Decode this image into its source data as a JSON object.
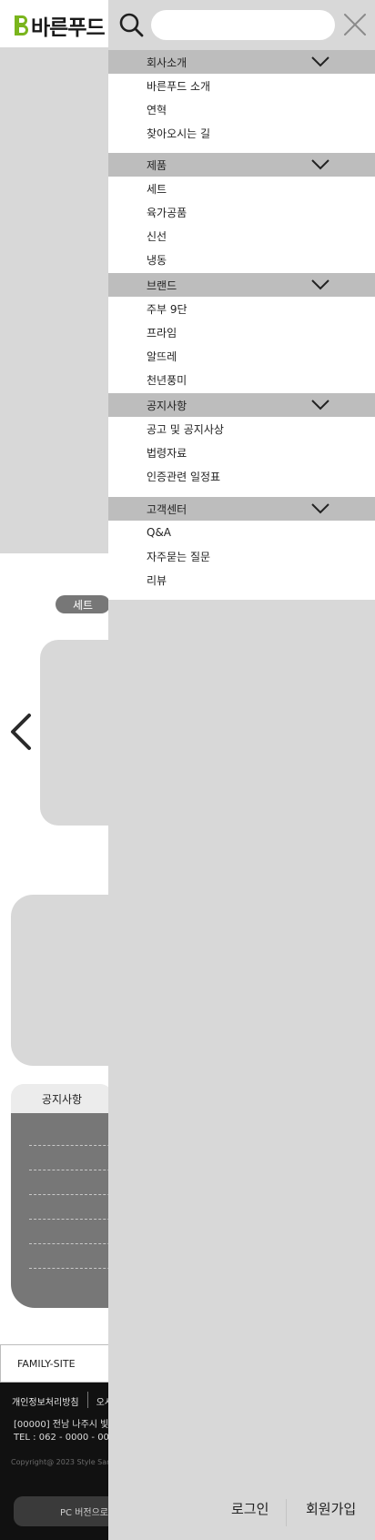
{
  "brand": {
    "logo_text": "바른푸드",
    "accent_color": "#7ab51d"
  },
  "page": {
    "badge": "세트",
    "notice_tab": "공지사항",
    "family_site": "FAMILY-SITE",
    "footer": {
      "link_privacy": "개인정보처리방침",
      "link_second": "오시",
      "address": "[00000] 전남 나주시 빛",
      "tel": "TEL : 062 - 0000 - 00",
      "copyright": "Copyright@ 2023 Style Sand",
      "pc_button": "PC 버전으로"
    }
  },
  "menu": {
    "search": {
      "value": "",
      "placeholder": ""
    },
    "sections": [
      {
        "title": "회사소개",
        "items": [
          "바른푸드 소개",
          "연혁",
          "찾아오시는 길"
        ]
      },
      {
        "title": "제품",
        "items": [
          "세트",
          "육가공품",
          "신선",
          "냉동"
        ]
      },
      {
        "title": "브랜드",
        "items": [
          "주부 9단",
          "프라임",
          "알뜨레",
          "천년풍미"
        ]
      },
      {
        "title": "공지사항",
        "items": [
          "공고 및 공지사상",
          "법령자료",
          "인증관련 일정표"
        ]
      },
      {
        "title": "고객센터",
        "items": [
          "Q&A",
          "자주묻는 질문",
          "리뷰"
        ]
      }
    ],
    "login": "로그인",
    "signup": "회원가입"
  }
}
